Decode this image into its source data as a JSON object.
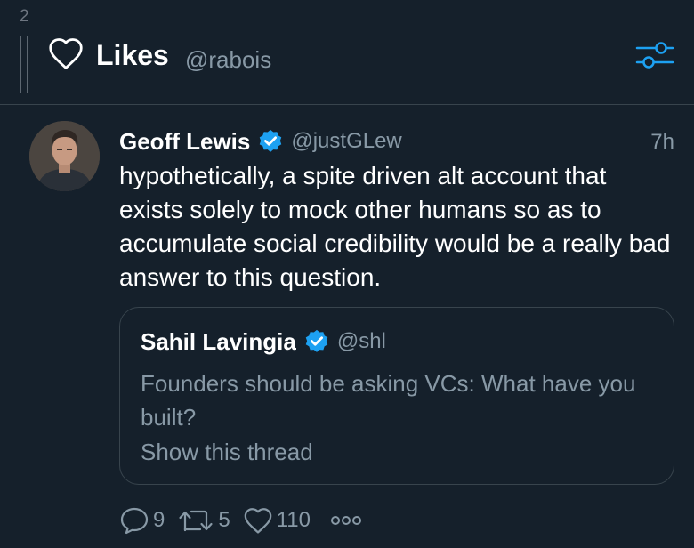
{
  "column": {
    "number": "2"
  },
  "header": {
    "title": "Likes",
    "handle": "@rabois",
    "icon": "heart-icon",
    "settings_icon": "sliders-icon"
  },
  "tweet": {
    "author_name": "Geoff Lewis",
    "author_handle": "@justGLew",
    "verified": true,
    "time": "7h",
    "text": "hypothetically, a spite driven alt account that exists solely to mock other humans so as to accumulate social credibility would be a really bad answer to this question.",
    "quoted": {
      "author_name": "Sahil Lavingia",
      "author_handle": "@shl",
      "verified": true,
      "text": "Founders should be asking VCs: What have you built?",
      "show_thread": "Show this thread"
    },
    "actions": {
      "replies": "9",
      "retweets": "5",
      "likes": "110",
      "more_icon": "more-dots-icon"
    }
  },
  "colors": {
    "background": "#15202b",
    "border": "#38444d",
    "muted_text": "#8899a6",
    "accent": "#1da1f2",
    "primary_text": "#ffffff"
  }
}
